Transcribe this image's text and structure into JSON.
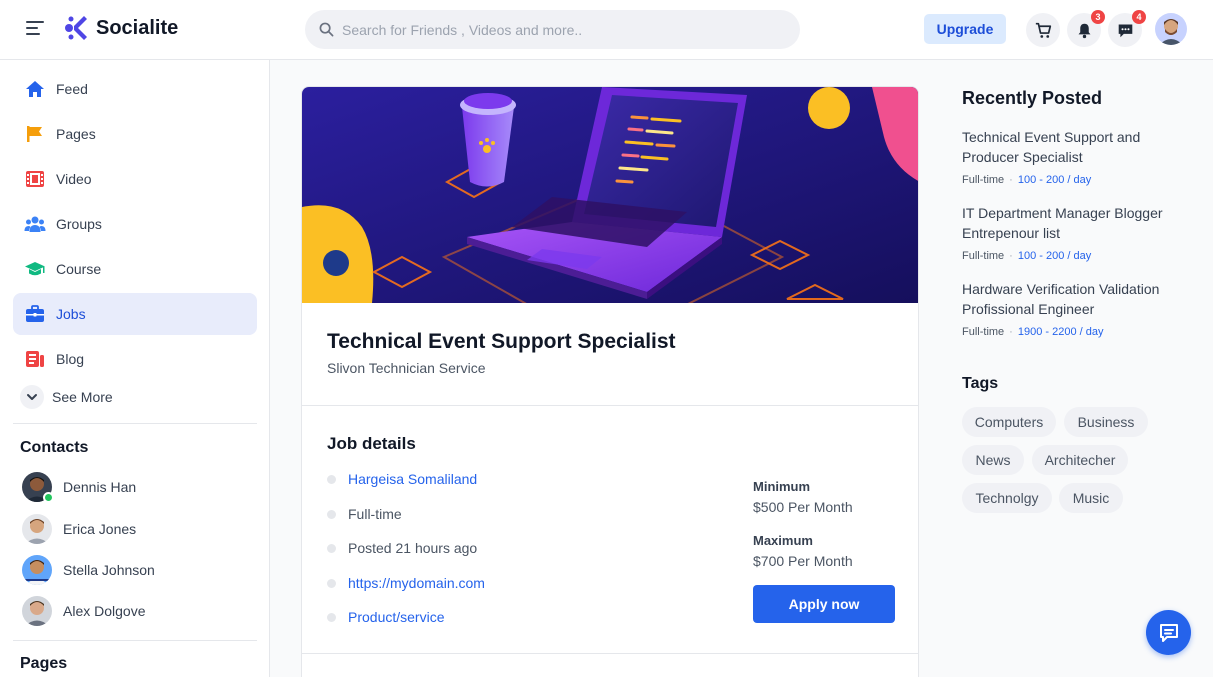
{
  "app": {
    "name": "Socialite"
  },
  "header": {
    "search_placeholder": "Search for Friends , Videos and more..",
    "upgrade_label": "Upgrade",
    "notifications_count": "3",
    "messages_count": "4"
  },
  "sidebar": {
    "items": [
      {
        "label": "Feed",
        "icon": "home-icon"
      },
      {
        "label": "Pages",
        "icon": "flag-icon"
      },
      {
        "label": "Video",
        "icon": "film-icon"
      },
      {
        "label": "Groups",
        "icon": "users-icon"
      },
      {
        "label": "Course",
        "icon": "graduation-cap-icon"
      },
      {
        "label": "Jobs",
        "icon": "briefcase-icon",
        "active": true
      },
      {
        "label": "Blog",
        "icon": "blog-icon"
      }
    ],
    "see_more_label": "See More",
    "contacts_heading": "Contacts",
    "contacts": [
      {
        "name": "Dennis Han",
        "online": true
      },
      {
        "name": "Erica Jones",
        "online": false
      },
      {
        "name": "Stella Johnson",
        "online": false
      },
      {
        "name": "Alex Dolgove",
        "online": false
      }
    ],
    "pages_heading": "Pages"
  },
  "job": {
    "title": "Technical Event Support Specialist",
    "company": "Slivon Technician Service",
    "details_heading": "Job details",
    "details": [
      {
        "text": "Hargeisa Somaliland",
        "link": true
      },
      {
        "text": "Full-time",
        "link": false
      },
      {
        "text": "Posted 21 hours ago",
        "link": false
      },
      {
        "text": "https://mydomain.com",
        "link": true
      },
      {
        "text": "Product/service",
        "link": true
      }
    ],
    "minimum_label": "Minimum",
    "minimum_value": "$500 Per Month",
    "maximum_label": "Maximum",
    "maximum_value": "$700 Per Month",
    "apply_label": "Apply now"
  },
  "recent": {
    "heading": "Recently Posted",
    "posts": [
      {
        "title": "Technical Event Support and Producer Specialist",
        "type": "Full-time",
        "rate": "100 - 200 / day"
      },
      {
        "title": "IT Department Manager Blogger Entrepenour list",
        "type": "Full-time",
        "rate": "100 - 200 / day"
      },
      {
        "title": "Hardware Verification Validation Profissional Engineer",
        "type": "Full-time",
        "rate": "1900 - 2200 / day"
      }
    ]
  },
  "tags": {
    "heading": "Tags",
    "items": [
      "Computers",
      "Business",
      "News",
      "Architecher",
      "Technolgy",
      "Music"
    ]
  },
  "colors": {
    "accent": "#2563eb",
    "active_bg": "#e8ecfb",
    "badge": "#ef4444",
    "hero_bg": "#1e1a78"
  }
}
